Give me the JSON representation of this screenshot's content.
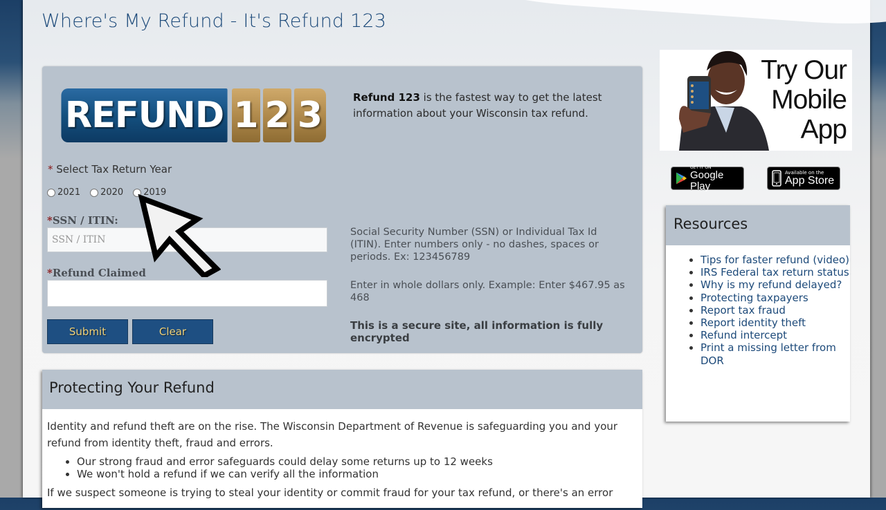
{
  "page": {
    "title": "Where's My Refund - It's Refund 123"
  },
  "logo": {
    "word": "REFUND",
    "digits": [
      "1",
      "2",
      "3"
    ]
  },
  "intro": {
    "bold": "Refund 123",
    "rest": " is the fastest way to get the latest information about your Wisconsin tax refund."
  },
  "form": {
    "year_label": "Select Tax Return Year",
    "required_mark": "*",
    "years": [
      {
        "label": "2021",
        "selected": false
      },
      {
        "label": "2020",
        "selected": false
      },
      {
        "label": "2019",
        "selected": false
      }
    ],
    "ssn": {
      "label": "SSN / ITIN:",
      "placeholder": "SSN / ITIN",
      "value": "",
      "help": "Social Security Number (SSN) or Individual Tax Id (ITIN). Enter numbers only - no dashes, spaces or periods. Ex: 123456789"
    },
    "refund": {
      "label": "Refund Claimed",
      "placeholder": "",
      "value": "",
      "help": "Enter in whole dollars only. Example: Enter $467.95 as 468"
    },
    "submit_label": "Submit",
    "clear_label": "Clear",
    "secure_note": "This is a secure site, all information is fully encrypted"
  },
  "protect": {
    "title": "Protecting Your Refund",
    "intro": "Identity and refund theft are on the rise. The Wisconsin Department of Revenue is safeguarding you and your refund from identity theft, fraud and errors.",
    "bullets": [
      "Our strong fraud and error safeguards could delay some returns up to 12 weeks",
      "We won't hold a refund if we can verify all the information"
    ],
    "cutoff": "If we suspect someone is trying to steal your identity or commit fraud for your tax refund, or there's an error"
  },
  "ad": {
    "line1": "Try Our",
    "line2": "Mobile",
    "line3": "App"
  },
  "stores": {
    "google_small": "GET IT ON",
    "google_big": "Google Play",
    "apple_small": "Available on the",
    "apple_big": "App Store"
  },
  "resources": {
    "title": "Resources",
    "links": [
      "Tips for faster refund (video)",
      "IRS Federal tax return status",
      "Why is my refund delayed?",
      "Protecting taxpayers",
      "Report tax fraud",
      "Report identity theft",
      "Refund intercept",
      "Print a missing letter from DOR"
    ]
  },
  "colors": {
    "brand_blue": "#1d4a7a",
    "button_bg": "#1e4f82",
    "button_text": "#f0d27a",
    "panel_bg": "#b8c2cd",
    "required": "#8b1a1a"
  }
}
